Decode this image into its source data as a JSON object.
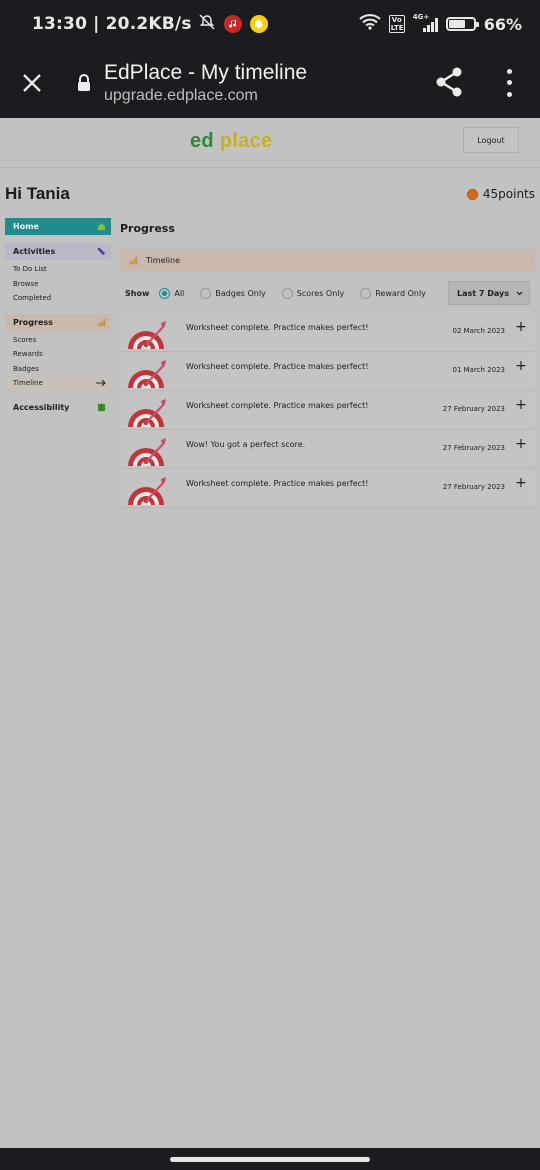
{
  "status_bar": {
    "time": "13:30",
    "speed": "| 20.2KB/s",
    "network": "4G+",
    "volte": "Vo LTE",
    "battery_pct": "66%",
    "battery_level": 0.66
  },
  "browser": {
    "title": "EdPlace - My timeline",
    "url": "upgrade.edplace.com"
  },
  "header": {
    "logo_part1": "ed ",
    "logo_part2": "place",
    "logout_label": "Logout"
  },
  "user": {
    "greeting": "Hi Tania",
    "points": "45points"
  },
  "sidebar": {
    "home": "Home",
    "activities": "Activities",
    "activities_items": [
      "To Do List",
      "Browse",
      "Completed"
    ],
    "progress": "Progress",
    "progress_items": [
      "Scores",
      "Rewards",
      "Badges",
      "Timeline"
    ],
    "accessibility": "Accessibility"
  },
  "main": {
    "title": "Progress",
    "timeline_label": "Timeline",
    "show_label": "Show",
    "filters": [
      "All",
      "Badges Only",
      "Scores Only",
      "Reward Only"
    ],
    "selected_filter": "All",
    "range_select": "Last 7 Days"
  },
  "timeline": [
    {
      "message": "Worksheet complete. Practice makes perfect!",
      "date": "02 March 2023"
    },
    {
      "message": "Worksheet complete. Practice makes perfect!",
      "date": "01 March 2023"
    },
    {
      "message": "Worksheet complete. Practice makes perfect!",
      "date": "27 February 2023"
    },
    {
      "message": "Wow! You got a perfect score.",
      "date": "27 February 2023"
    },
    {
      "message": "Worksheet complete. Practice makes perfect!",
      "date": "27 February 2023"
    }
  ],
  "colors": {
    "teal": "#1f8d8d",
    "progress_tint": "#c9b8ac",
    "target_red": "#c0353a"
  }
}
